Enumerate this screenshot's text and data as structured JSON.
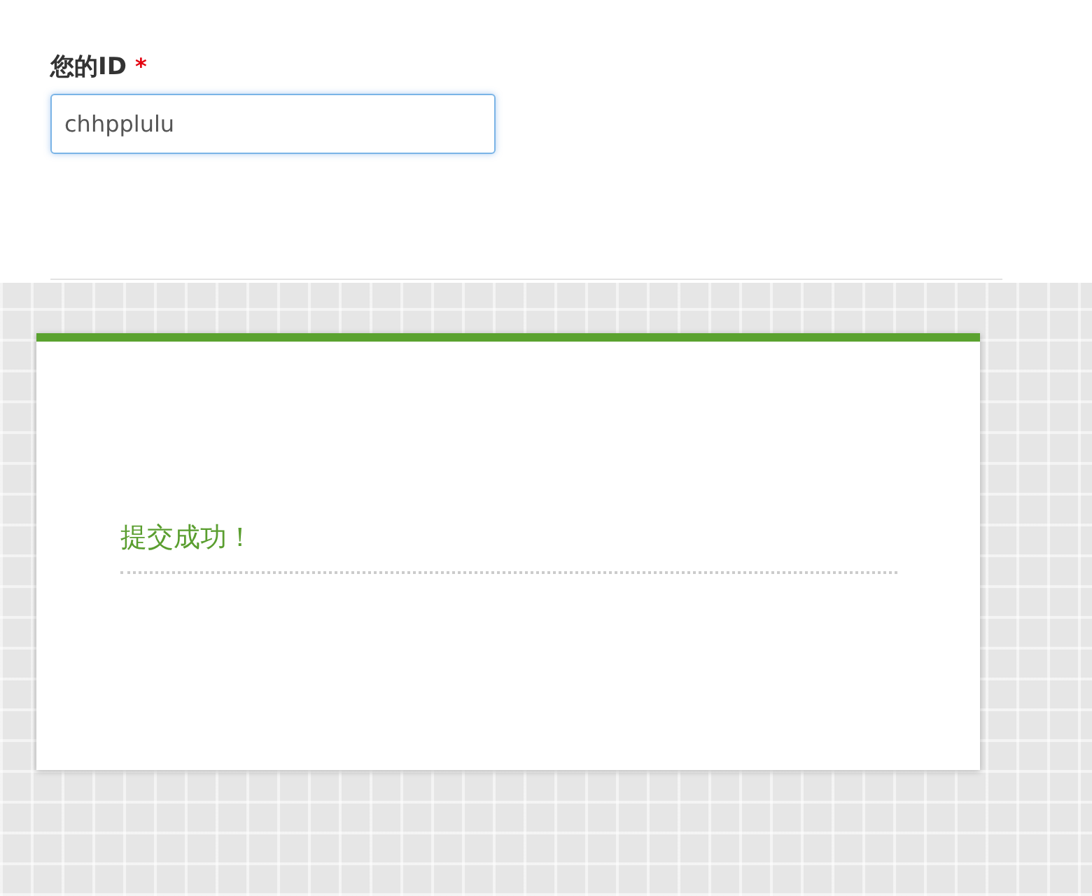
{
  "form": {
    "label": "您的ID",
    "required_mark": "*",
    "value": "chhpplulu",
    "focused": true
  },
  "message": {
    "text": "提交成功！"
  }
}
